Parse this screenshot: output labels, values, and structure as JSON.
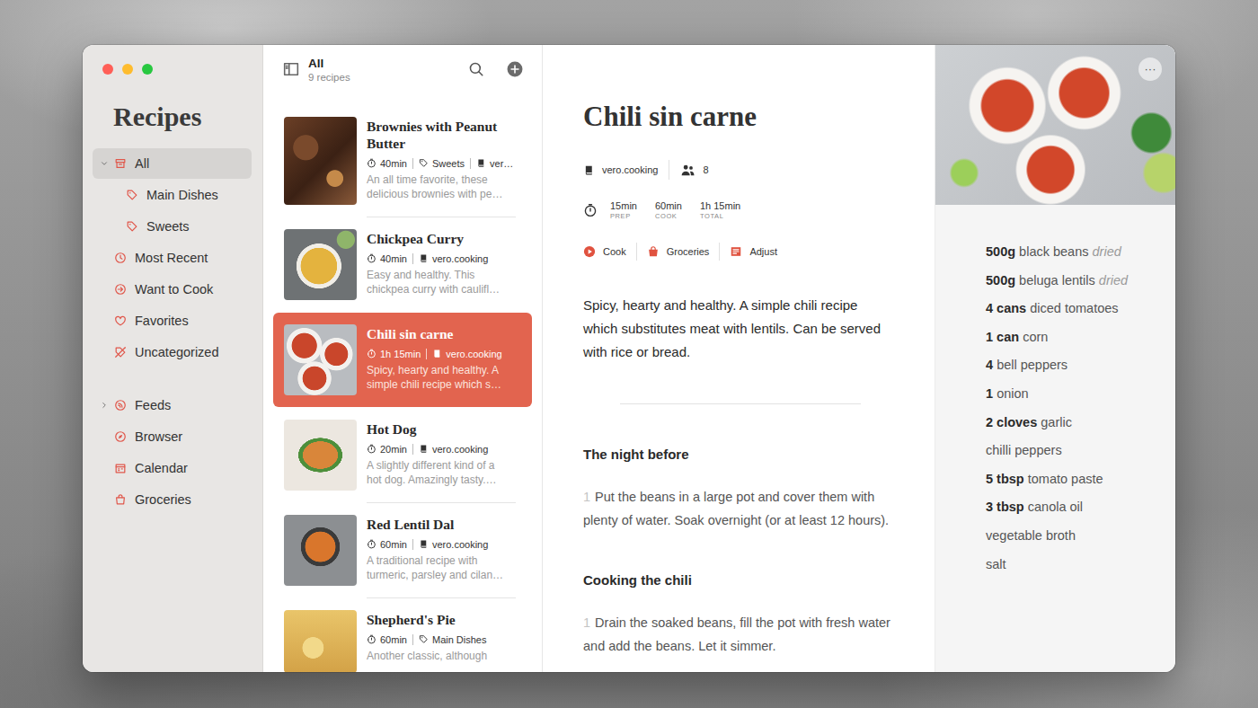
{
  "sidebar": {
    "title": "Recipes",
    "items": [
      {
        "label": "All",
        "selected": true,
        "expanded": true,
        "children": [
          {
            "label": "Main Dishes",
            "selected": false
          },
          {
            "label": "Sweets",
            "selected": false
          }
        ]
      },
      {
        "label": "Most Recent",
        "selected": false
      },
      {
        "label": "Want to Cook",
        "selected": false
      },
      {
        "label": "Favorites",
        "selected": false
      },
      {
        "label": "Uncategorized",
        "selected": false
      }
    ],
    "library": [
      {
        "label": "Feeds",
        "selected": false,
        "expanded": false
      },
      {
        "label": "Browser",
        "selected": false
      },
      {
        "label": "Calendar",
        "selected": false
      },
      {
        "label": "Groceries",
        "selected": false
      }
    ]
  },
  "list": {
    "title": "All",
    "count": "9 recipes",
    "recipes": [
      {
        "name": "Brownies with Peanut Butter",
        "time": "40min",
        "meta": [
          {
            "kind": "tag",
            "text": "Sweets"
          },
          {
            "kind": "source",
            "text": "ver…"
          }
        ],
        "description": [
          "An all time favorite, these",
          "delicious brownies with pe…"
        ],
        "selected": false
      },
      {
        "name": "Chickpea Curry",
        "time": "40min",
        "meta": [
          {
            "kind": "source",
            "text": "vero.cooking"
          }
        ],
        "description": [
          "Easy and healthy. This",
          "chickpea curry with caulifl…"
        ],
        "selected": false
      },
      {
        "name": "Chili sin carne",
        "time": "1h 15min",
        "meta": [
          {
            "kind": "source",
            "text": "vero.cooking"
          }
        ],
        "description": [
          "Spicy, hearty and healthy. A",
          "simple chili recipe which s…"
        ],
        "selected": true
      },
      {
        "name": "Hot Dog",
        "time": "20min",
        "meta": [
          {
            "kind": "source",
            "text": "vero.cooking"
          }
        ],
        "description": [
          "A slightly different kind of a",
          "hot dog. Amazingly tasty.…"
        ],
        "selected": false
      },
      {
        "name": "Red Lentil Dal",
        "time": "60min",
        "meta": [
          {
            "kind": "source",
            "text": "vero.cooking"
          }
        ],
        "description": [
          "A traditional recipe with",
          "turmeric, parsley and cilan…"
        ],
        "selected": false
      },
      {
        "name": "Shepherd's Pie",
        "time": "60min",
        "meta": [
          {
            "kind": "tag",
            "text": "Main Dishes"
          }
        ],
        "description": [
          "Another classic, although"
        ],
        "selected": false
      }
    ]
  },
  "recipe": {
    "title": "Chili sin carne",
    "source": "vero.cooking",
    "servings": "8",
    "times": [
      {
        "value": "15min",
        "label": "PREP"
      },
      {
        "value": "60min",
        "label": "COOK"
      },
      {
        "value": "1h 15min",
        "label": "TOTAL"
      }
    ],
    "actions": [
      "Cook",
      "Groceries",
      "Adjust"
    ],
    "description": "Spicy, hearty and healthy. A simple chili recipe which substitutes meat with lentils. Can be served with rice or bread.",
    "sections": [
      {
        "title": "The night before",
        "steps": [
          {
            "number": "1",
            "text": "Put the beans in a large pot and cover them with plenty of water. Soak overnight (or at least 12 hours)."
          }
        ]
      },
      {
        "title": "Cooking the chili",
        "steps": [
          {
            "number": "1",
            "text": "Drain the soaked beans, fill the pot with fresh water and add the beans. Let it simmer."
          }
        ]
      }
    ]
  },
  "side_panel": {
    "more_button": "···",
    "ingredients": [
      {
        "amount": "500g",
        "name": "black beans",
        "note": "dried"
      },
      {
        "amount": "500g",
        "name": "beluga lentils",
        "note": "dried"
      },
      {
        "amount": "4 cans",
        "name": "diced tomatoes",
        "note": ""
      },
      {
        "amount": "1 can",
        "name": "corn",
        "note": ""
      },
      {
        "amount": "4",
        "name": "bell peppers",
        "note": ""
      },
      {
        "amount": "1",
        "name": "onion",
        "note": ""
      },
      {
        "amount": "2 cloves",
        "name": "garlic",
        "note": ""
      },
      {
        "amount": "",
        "name": "chilli peppers",
        "note": ""
      },
      {
        "amount": "5 tbsp",
        "name": "tomato paste",
        "note": ""
      },
      {
        "amount": "3 tbsp",
        "name": "canola oil",
        "note": ""
      },
      {
        "amount": "",
        "name": "vegetable broth",
        "note": ""
      },
      {
        "amount": "",
        "name": "salt",
        "note": ""
      }
    ]
  }
}
